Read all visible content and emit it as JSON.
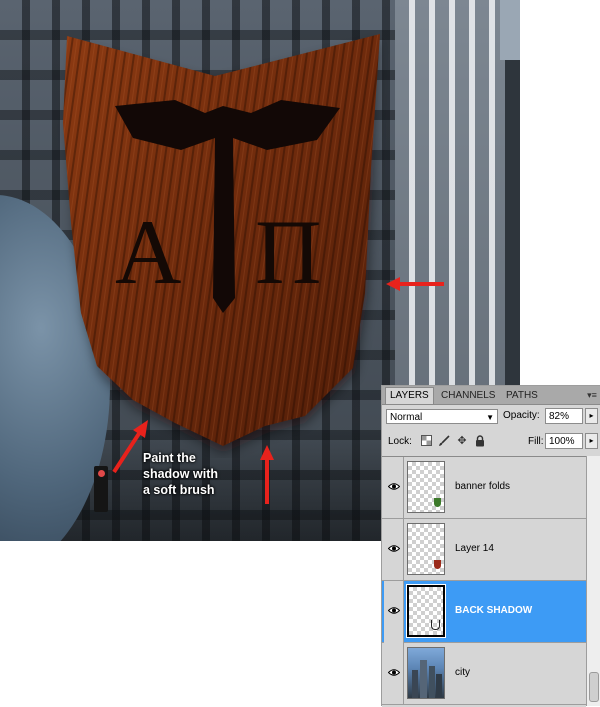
{
  "annotation": {
    "text_lines": [
      "Paint the",
      "shadow with",
      "a soft brush"
    ],
    "arrow_color": "#e8221c"
  },
  "banner": {
    "letter_left": "A",
    "letter_right": "Π",
    "color": "#7a2f10"
  },
  "panel": {
    "tabs": [
      {
        "label": "LAYERS",
        "active": true
      },
      {
        "label": "CHANNELS",
        "active": false
      },
      {
        "label": "PATHS",
        "active": false
      }
    ],
    "menu_icon": "panel-menu-icon",
    "blend_mode": "Normal",
    "opacity_label": "Opacity:",
    "opacity_value": "82%",
    "lock_label": "Lock:",
    "lock_icons": [
      "lock-transparency-icon",
      "lock-paint-icon",
      "lock-move-icon",
      "lock-all-icon"
    ],
    "fill_label": "Fill:",
    "fill_value": "100%",
    "layers": [
      {
        "name": "banner folds",
        "visible": true,
        "selected": false,
        "thumb_mark_color": "#3c7a2a"
      },
      {
        "name": "Layer 14",
        "visible": true,
        "selected": false,
        "thumb_mark_color": "#9b2a1a"
      },
      {
        "name": "BACK SHADOW",
        "visible": true,
        "selected": true,
        "thumb_mark_color": "#222222"
      },
      {
        "name": "city",
        "visible": true,
        "selected": false,
        "thumb_mark_color": ""
      }
    ],
    "selected_color": "#3d9bf5"
  }
}
